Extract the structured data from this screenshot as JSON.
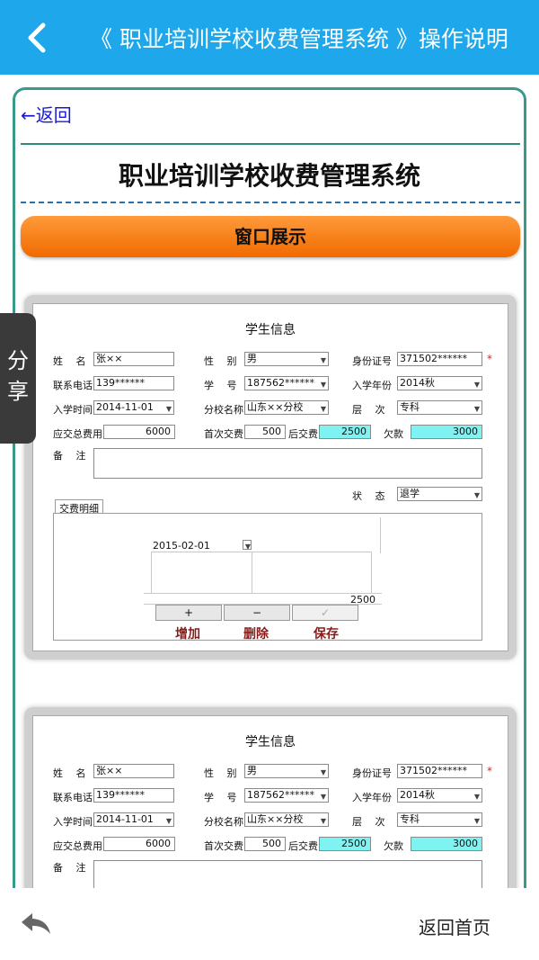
{
  "header": {
    "title": "《 职业培训学校收费管理系统 》操作说明",
    "back_icon": "chevron-left-icon"
  },
  "content": {
    "return_link": "←返回",
    "doc_title": "职业培训学校收费管理系统",
    "section_button": "窗口展示"
  },
  "form": {
    "title": "学生信息",
    "labels": {
      "name": "姓　 名",
      "gender": "性　 别",
      "id_no": "身份证号",
      "phone": "联系电话",
      "student_no": "学　 号",
      "enroll_year": "入学年份",
      "enroll_time": "入学时间",
      "branch": "分校名称",
      "level": "层　 次",
      "total_fee": "应交总费用",
      "first_pay": "首次交费",
      "later_pay": "后交费",
      "owed": "欠款",
      "remark": "备　 注",
      "status": "状　 态"
    },
    "values": {
      "name": "张××",
      "gender": "男",
      "id_no": "371502******",
      "phone": "139******",
      "student_no": "187562******",
      "enroll_year": "2014秋",
      "enroll_time": "2014-11-01",
      "branch": "山东××分校",
      "level": "专科",
      "total_fee": "6000",
      "first_pay": "500",
      "later_pay": "2500",
      "owed": "3000",
      "status": "退学"
    },
    "required_mark": "*",
    "tab": "交费明细",
    "grid": {
      "date": "2015-02-01",
      "amount": "2500"
    },
    "buttons": {
      "add_symbol": "+",
      "delete_symbol": "−",
      "save_symbol": "✓",
      "add": "增加",
      "delete": "删除",
      "save": "保存"
    }
  },
  "share": {
    "label_1": "分",
    "label_2": "享"
  },
  "footer": {
    "back_icon": "reply-arrow-icon",
    "home_link": "返回首页"
  }
}
